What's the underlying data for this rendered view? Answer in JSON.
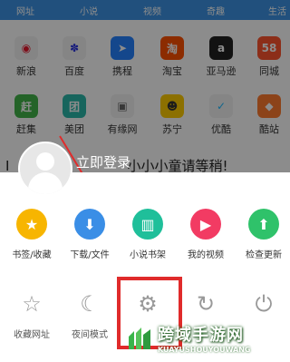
{
  "nav": [
    "网址",
    "小说",
    "视频",
    "奇趣",
    "生活"
  ],
  "sites": [
    {
      "label": "新浪",
      "icon": "weibo-icon",
      "glyph": "◉",
      "color": "#f2f2f2",
      "fg": "#e6162d"
    },
    {
      "label": "百度",
      "icon": "baidu-paw-icon",
      "glyph": "✽",
      "color": "#f2f2f2",
      "fg": "#2932e1"
    },
    {
      "label": "携程",
      "icon": "ctrip-icon",
      "glyph": "➤",
      "color": "#2681ff",
      "fg": "#fff"
    },
    {
      "label": "淘宝",
      "icon": "taobao-icon",
      "glyph": "淘",
      "color": "#ff5000",
      "fg": "#fff"
    },
    {
      "label": "亚马逊",
      "icon": "amazon-icon",
      "glyph": "a",
      "color": "#222",
      "fg": "#fff"
    },
    {
      "label": "同城",
      "icon": "tongcheng-icon",
      "glyph": "58",
      "color": "#ff552e",
      "fg": "#fff"
    },
    {
      "label": "赶集",
      "icon": "ganji-icon",
      "glyph": "赶",
      "color": "#43b549",
      "fg": "#fff"
    },
    {
      "label": "美团",
      "icon": "meituan-icon",
      "glyph": "团",
      "color": "#2bb8aa",
      "fg": "#fff"
    },
    {
      "label": "有缘网",
      "icon": "youyuan-icon",
      "glyph": "▣",
      "color": "#f2f2f2",
      "fg": "#666"
    },
    {
      "label": "苏宁",
      "icon": "suning-lion-icon",
      "glyph": "☻",
      "color": "#ffcc00",
      "fg": "#333"
    },
    {
      "label": "优酷",
      "icon": "youku-icon",
      "glyph": "✓",
      "color": "#f2f2f2",
      "fg": "#1ebaff"
    },
    {
      "label": "酷站",
      "icon": "kuzhan-icon",
      "glyph": "◆",
      "color": "#ff7a2f",
      "fg": "#fff"
    }
  ],
  "headline": "小小小童请等稍!",
  "headline_prefix": "I",
  "user": {
    "login": "立即登录"
  },
  "menu_row1": [
    {
      "label": "书签/收藏",
      "icon": "star-icon",
      "glyph": "★",
      "color": "#f7b500"
    },
    {
      "label": "下载/文件",
      "icon": "download-icon",
      "glyph": "⬇",
      "color": "#3a8ee6"
    },
    {
      "label": "小说书架",
      "icon": "book-icon",
      "glyph": "▥",
      "color": "#1fbf9a"
    },
    {
      "label": "我的视频",
      "icon": "play-icon",
      "glyph": "▶",
      "color": "#f23b63"
    },
    {
      "label": "检查更新",
      "icon": "upload-arrow-icon",
      "glyph": "⬆",
      "color": "#2fc26a"
    }
  ],
  "menu_row2": [
    {
      "label": "收藏网址",
      "icon": "add-favorite-icon",
      "glyph": "☆"
    },
    {
      "label": "夜间模式",
      "icon": "moon-icon",
      "glyph": "☾"
    },
    {
      "label": "",
      "icon": "settings-gear-icon",
      "glyph": "⚙"
    },
    {
      "label": "",
      "icon": "refresh-icon",
      "glyph": "↻"
    },
    {
      "label": "",
      "icon": "power-icon",
      "glyph": "⏻"
    }
  ],
  "watermark": {
    "title": "跨域手游网",
    "subtitle": "KUAYUSHOUYOUWANG"
  },
  "colors": {
    "nav_bg": "#3d93e4",
    "highlight": "#e02b2b",
    "arrow": "#e02b2b"
  }
}
